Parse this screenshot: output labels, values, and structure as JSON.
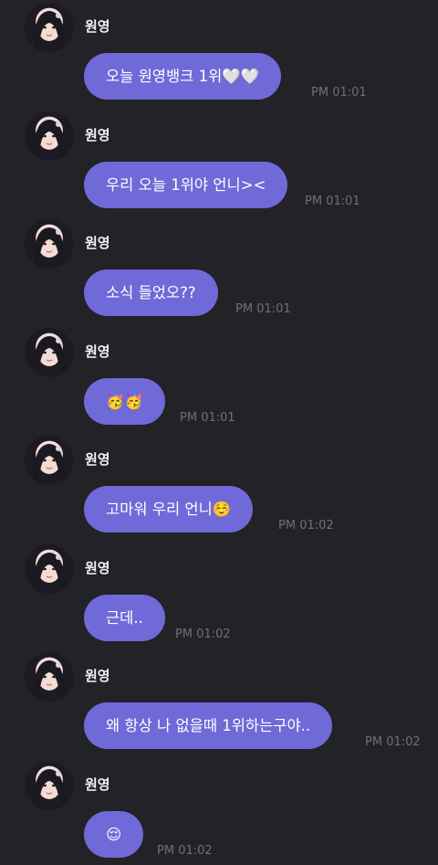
{
  "sender_name": "원영",
  "messages": [
    {
      "text": "오늘 원영뱅크 1위🤍🤍",
      "time": "PM 01:01"
    },
    {
      "text": "우리 오늘 1위야 언니><",
      "time": "PM 01:01"
    },
    {
      "text": "소식 들었오??",
      "time": "PM 01:01"
    },
    {
      "text": "🥳🥳",
      "time": "PM 01:01"
    },
    {
      "text": "고마워 우리 언니☺️",
      "time": "PM 01:02"
    },
    {
      "text": "근데..",
      "time": "PM 01:02"
    },
    {
      "text": "왜 항상 나 없을때 1위하는구야..",
      "time": "PM 01:02"
    },
    {
      "text": "😌",
      "time": "PM 01:02"
    }
  ],
  "colors": {
    "background": "#222227",
    "bubble": "#7069d8",
    "time": "#6f6f78"
  }
}
